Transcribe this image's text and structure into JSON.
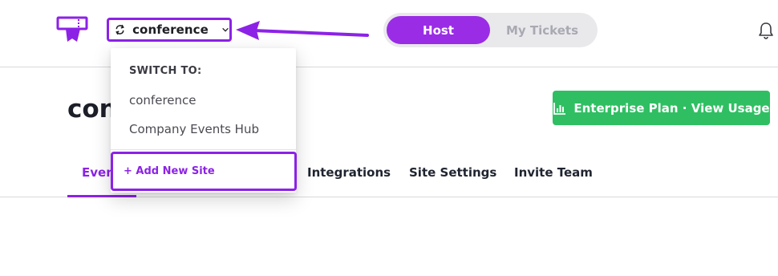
{
  "header": {
    "site_name": "conference",
    "toggle": {
      "host_label": "Host",
      "tickets_label": "My Tickets"
    }
  },
  "page": {
    "title": "conference",
    "enterprise_button": "Enterprise Plan · View Usage"
  },
  "tabs": [
    {
      "label": "Events"
    },
    {
      "label": "Integrations"
    },
    {
      "label": "Site Settings"
    },
    {
      "label": "Invite Team"
    }
  ],
  "dropdown": {
    "heading": "SWITCH TO:",
    "items": [
      {
        "label": "conference"
      },
      {
        "label": "Company Events Hub"
      }
    ],
    "add_site_label": "+ Add New Site"
  },
  "colors": {
    "accent": "#8c22e6",
    "host_pill": "#9a2ce6",
    "enterprise_green": "#2fbf62"
  },
  "icons": {
    "logo": "ticket-logo-icon",
    "switch": "switch-arrows-icon",
    "chevron": "chevron-down-icon",
    "bell": "bell-icon",
    "chart": "bar-chart-icon",
    "annotation": "annotation-arrow"
  }
}
